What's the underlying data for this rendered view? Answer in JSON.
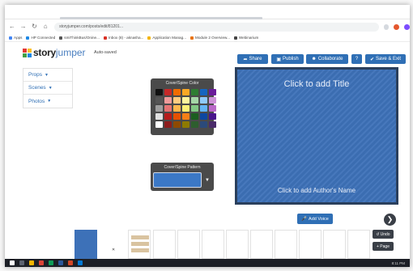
{
  "browser": {
    "url": "storyjumper.com/posts/edit/81201...",
    "bookmarks": [
      {
        "label": "Apps",
        "color": "#4285f4"
      },
      {
        "label": "HP Connected",
        "color": "#1e88e5"
      },
      {
        "label": "smiThinkBus/Onine...",
        "color": "#555555"
      },
      {
        "label": "Inbox (8) - aknasha...",
        "color": "#d93025"
      },
      {
        "label": "Application Manag...",
        "color": "#f4b400"
      },
      {
        "label": "Module 2 Overview...",
        "color": "#e8710a"
      },
      {
        "label": "Webinarium",
        "color": "#444444"
      }
    ]
  },
  "app": {
    "logo_main": "story",
    "logo_accent": "jumper",
    "autosaved": "Auto-saved"
  },
  "toolbar": {
    "share": "Share",
    "publish": "Publish",
    "collaborate": "Collaborate",
    "help": "?",
    "save_exit": "Save & Exit"
  },
  "menu": {
    "props": "Props",
    "scenes": "Scenes",
    "photos": "Photos"
  },
  "color_picker": {
    "title": "Cover/Spine Color",
    "colors": [
      "#111111",
      "#c62828",
      "#ef6c00",
      "#f9a825",
      "#2e7d32",
      "#1565c0",
      "#6a1b9a",
      "#555555",
      "#ef9a9a",
      "#ffcc80",
      "#fff59d",
      "#a5d6a7",
      "#90caf9",
      "#ce93d8",
      "#9e9e9e",
      "#e57373",
      "#ffb74d",
      "#fff176",
      "#81c784",
      "#64b5f6",
      "#ba68c8",
      "#e0e0e0",
      "#b71c1c",
      "#e65100",
      "#f57f17",
      "#1b5e20",
      "#0d47a1",
      "#4a148c",
      "#ffffff",
      "#8d1c1c",
      "#8d4a00",
      "#8d7a00",
      "#2e5e2e",
      "#2b4a7a",
      "#4a2b6a"
    ]
  },
  "pattern_picker": {
    "title": "Cover/Spine Pattern"
  },
  "cover": {
    "title": "Click to add Title",
    "author": "Click to add Author's Name"
  },
  "actions": {
    "add_voice": "Add Voice",
    "undo": "Undo",
    "add_page": "+ Page"
  },
  "taskbar": {
    "time": "8:11 PM"
  }
}
